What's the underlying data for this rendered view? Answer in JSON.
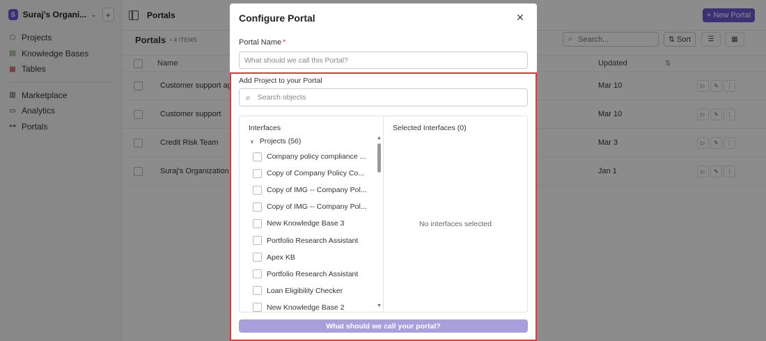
{
  "org": {
    "initial": "S",
    "name": "Suraj's Organi..."
  },
  "sidebar": {
    "items": [
      {
        "label": "Projects",
        "icon": "cube-icon"
      },
      {
        "label": "Knowledge Bases",
        "icon": "book-icon"
      },
      {
        "label": "Tables",
        "icon": "table-icon"
      },
      {
        "label": "Marketplace",
        "icon": "store-icon"
      },
      {
        "label": "Analytics",
        "icon": "chart-icon"
      },
      {
        "label": "Portals",
        "icon": "portal-icon"
      }
    ]
  },
  "header": {
    "title": "Portals",
    "new_portal_label": "+ New Portal"
  },
  "list": {
    "title": "Portals",
    "count": "• 4 ITEMS",
    "search_placeholder": "Search...",
    "sort_label": "Sort",
    "columns": {
      "name": "Name",
      "updated": "Updated"
    },
    "rows": [
      {
        "name": "Customer support age",
        "updated": "Mar 10"
      },
      {
        "name": "Customer support",
        "updated": "Mar 10"
      },
      {
        "name": "Credit Risk Team",
        "updated": "Mar 3"
      },
      {
        "name": "Suraj's Organization Pr",
        "updated": "Jan 1"
      }
    ]
  },
  "modal": {
    "title": "Configure Portal",
    "close_glyph": "✕",
    "portal_name_label": "Portal Name",
    "required_mark": "*",
    "portal_name_placeholder": "What should we call this Portal?",
    "add_project_label": "Add Project to your Portal",
    "search_placeholder": "Search objects",
    "interfaces_label": "Interfaces",
    "group_label": "Projects (56)",
    "items": [
      "Company policy compliance ...",
      "Copy of Company Policy Co...",
      "Copy of IMG -- Company Pol...",
      "Copy of IMG -- Company Pol...",
      "New Knowledge Base 3",
      "Portfolio Research Assistant",
      "Apex KB",
      "Portfolio Research Assistant",
      "Loan Eligibility Checker",
      "New Knowledge Base 2"
    ],
    "selected_label": "Selected Interfaces (0)",
    "empty_text": "No interfaces selected",
    "submit_label": "What should we call your portal?"
  },
  "colors": {
    "accent": "#6b5bd6",
    "submit_disabled": "#a99fdc",
    "highlight": "#e53935",
    "required": "#e03b3b"
  }
}
